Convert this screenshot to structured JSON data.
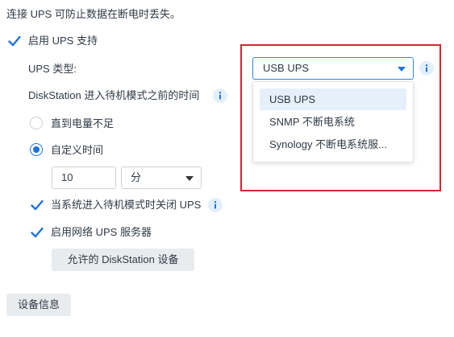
{
  "intro_text": "连接 UPS 可防止数据在断电时丢失。",
  "enable_ups": {
    "label": "启用 UPS 支持",
    "checked": true
  },
  "ups_type": {
    "label": "UPS 类型:",
    "value": "USB UPS",
    "options": [
      "USB UPS",
      "SNMP 不断电系统",
      "Synology 不断电系统服..."
    ]
  },
  "standby_time": {
    "label": "DiskStation 进入待机模式之前的时间",
    "option_low_battery": "直到电量不足",
    "option_custom": "自定义时间",
    "custom_value": "10",
    "unit_value": "分"
  },
  "shutdown_ups": {
    "label": "当系统进入待机模式时关闭 UPS",
    "checked": true
  },
  "network_ups": {
    "label": "启用网络 UPS 服务器",
    "checked": true
  },
  "allowed_button": "允许的 DiskStation 设备",
  "device_info_button": "设备信息",
  "colors": {
    "accent": "#1d74e0",
    "highlight": "#d9262a"
  }
}
